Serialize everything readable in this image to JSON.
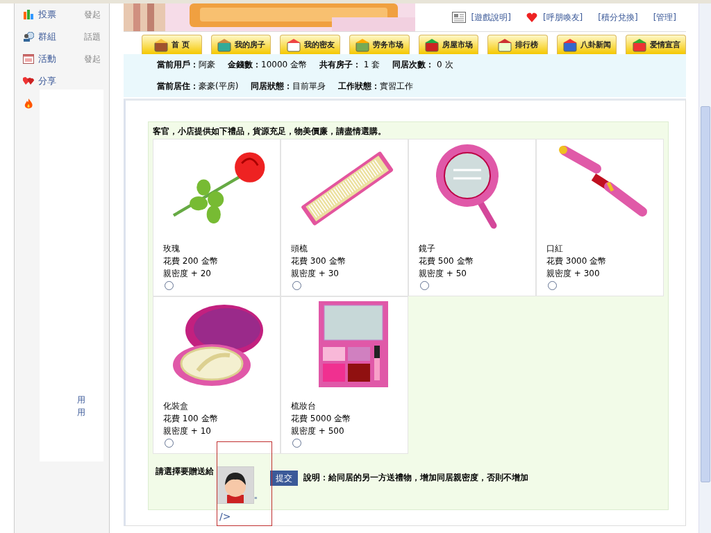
{
  "sidebar": {
    "items": [
      {
        "kind": "link",
        "label": "投票",
        "action": "發起"
      },
      {
        "kind": "link",
        "label": "群組",
        "action": "話題"
      },
      {
        "kind": "link",
        "label": "活動",
        "action": "發起"
      },
      {
        "kind": "link",
        "label": "分享"
      },
      {
        "kind": "icon"
      }
    ],
    "fragments": [
      "用",
      "用"
    ]
  },
  "header": {
    "links": [
      {
        "label": "[遊戲說明]"
      },
      {
        "label": "[呼朋喚友]"
      },
      {
        "label": "[積分兌換]"
      },
      {
        "label": "[管理]"
      }
    ]
  },
  "nav_tabs": [
    {
      "label": "首 页"
    },
    {
      "label": "我的房子"
    },
    {
      "label": "我的密友"
    },
    {
      "label": "劳务市场"
    },
    {
      "label": "房屋市场"
    },
    {
      "label": "排行榜"
    },
    {
      "label": "八卦新闻"
    },
    {
      "label": "爱情宣言"
    }
  ],
  "status": {
    "line1": [
      {
        "label": "當前用戶：",
        "value": "阿豪"
      },
      {
        "label": "金錢數：",
        "value": "10000 金幣"
      },
      {
        "label": "共有房子：",
        "value": " 1 套"
      },
      {
        "label": "同居次數：",
        "value": " 0 次"
      }
    ],
    "line2": [
      {
        "label": "當前居住：",
        "value": "豪豪(平房)"
      },
      {
        "label": "同居狀態：",
        "value": "目前單身"
      },
      {
        "label": "工作狀態：",
        "value": "實習工作"
      }
    ]
  },
  "shop": {
    "intro": "客官，小店提供如下禮品，貨源充足，物美價廉，請盡情選購。",
    "gifts": [
      {
        "kind": "rose",
        "name": "玫瑰",
        "cost": "花費 200 金幣",
        "intimacy": "親密度 + 20",
        "selected": false
      },
      {
        "kind": "comb",
        "name": "頭梳",
        "cost": "花費 300 金幣",
        "intimacy": "親密度 + 30",
        "selected": false
      },
      {
        "kind": "mirror",
        "name": "鏡子",
        "cost": "花費 500 金幣",
        "intimacy": "親密度 + 50",
        "selected": false
      },
      {
        "kind": "lipstick",
        "name": "口紅",
        "cost": "花費 3000 金幣",
        "intimacy": "親密度 + 300",
        "selected": false
      },
      {
        "kind": "compact",
        "name": "化裝盒",
        "cost": "花費 100 金幣",
        "intimacy": "親密度 + 10",
        "selected": false
      },
      {
        "kind": "palette",
        "name": "梳妝台",
        "cost": "花費 5000 金幣",
        "intimacy": "親密度 + 500",
        "selected": false
      }
    ],
    "recipient_label": "請選擇要贈送給",
    "avatar_suffix": "\"",
    "stray_text": "/>",
    "submit": "提交",
    "note": "說明：給同居的另一方送禮物，增加同居親密度，否則不增加"
  }
}
